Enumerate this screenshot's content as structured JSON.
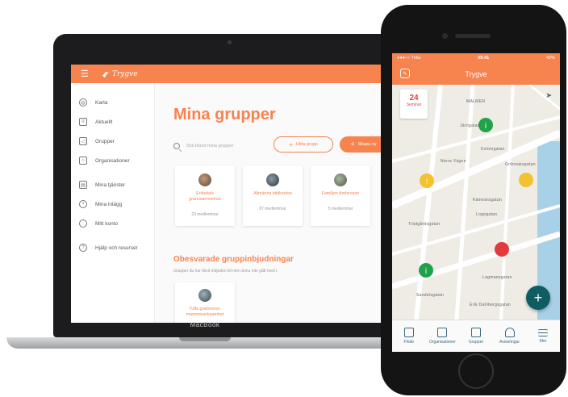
{
  "laptop": {
    "brand": "Trygve",
    "device_label": "MacBook",
    "sidebar": [
      {
        "label": "Karta",
        "icon": "globe-icon"
      },
      {
        "label": "Aktuellt",
        "icon": "news-icon"
      },
      {
        "label": "Grupper",
        "icon": "megaphone-icon"
      },
      {
        "label": "Organisationer",
        "icon": "building-icon"
      },
      {
        "label": "Mina tjänster",
        "icon": "shop-icon"
      },
      {
        "label": "Mina inlägg",
        "icon": "location-icon"
      },
      {
        "label": "Mitt konto",
        "icon": "user-icon"
      },
      {
        "label": "Hjälp och resurser",
        "icon": "help-icon"
      }
    ],
    "page_title": "Mina grupper",
    "search_placeholder": "Sök bland mina grupper",
    "join_button": "Hitta grupp",
    "create_button": "Skapa ny",
    "groups": [
      {
        "name": "Eriksdals grannsamverkan",
        "members": "23 medlemmar"
      },
      {
        "name": "Allmänna biblioteket",
        "members": "87 medlemmar"
      },
      {
        "name": "Familjen Andersson",
        "members": "5 medlemmar"
      }
    ],
    "pending_title": "Obesvarade gruppinbjudningar",
    "pending_subtitle": "Grupper du har blivit inbjuden till men ännu inte gått med i.",
    "pending_group": "Tuffa gratisresor, mammaverksamhet"
  },
  "phone": {
    "carrier": "●●●○○ Telia",
    "time": "09:41",
    "battery": "42%",
    "title": "Trygve",
    "date_day": "24",
    "date_label": "Seminar",
    "map_labels": [
      "MALMEN",
      "Kolonigatan",
      "Grönsaksgatan",
      "Järngatan",
      "Trädgårdsgatan",
      "Kämnärsgatan",
      "Logegatan",
      "Lagmansgatan",
      "Erik Dahlbergsgatan",
      "Norra Vägen",
      "Sandelsgatan"
    ],
    "fab_label": "+",
    "tabs": [
      "Flöde",
      "Organisationer",
      "Grupper",
      "Aviseringar",
      "Mer"
    ]
  },
  "colors": {
    "accent": "#f7834f",
    "teal": "#0f5d63",
    "tab_icon": "#3a6b83"
  }
}
